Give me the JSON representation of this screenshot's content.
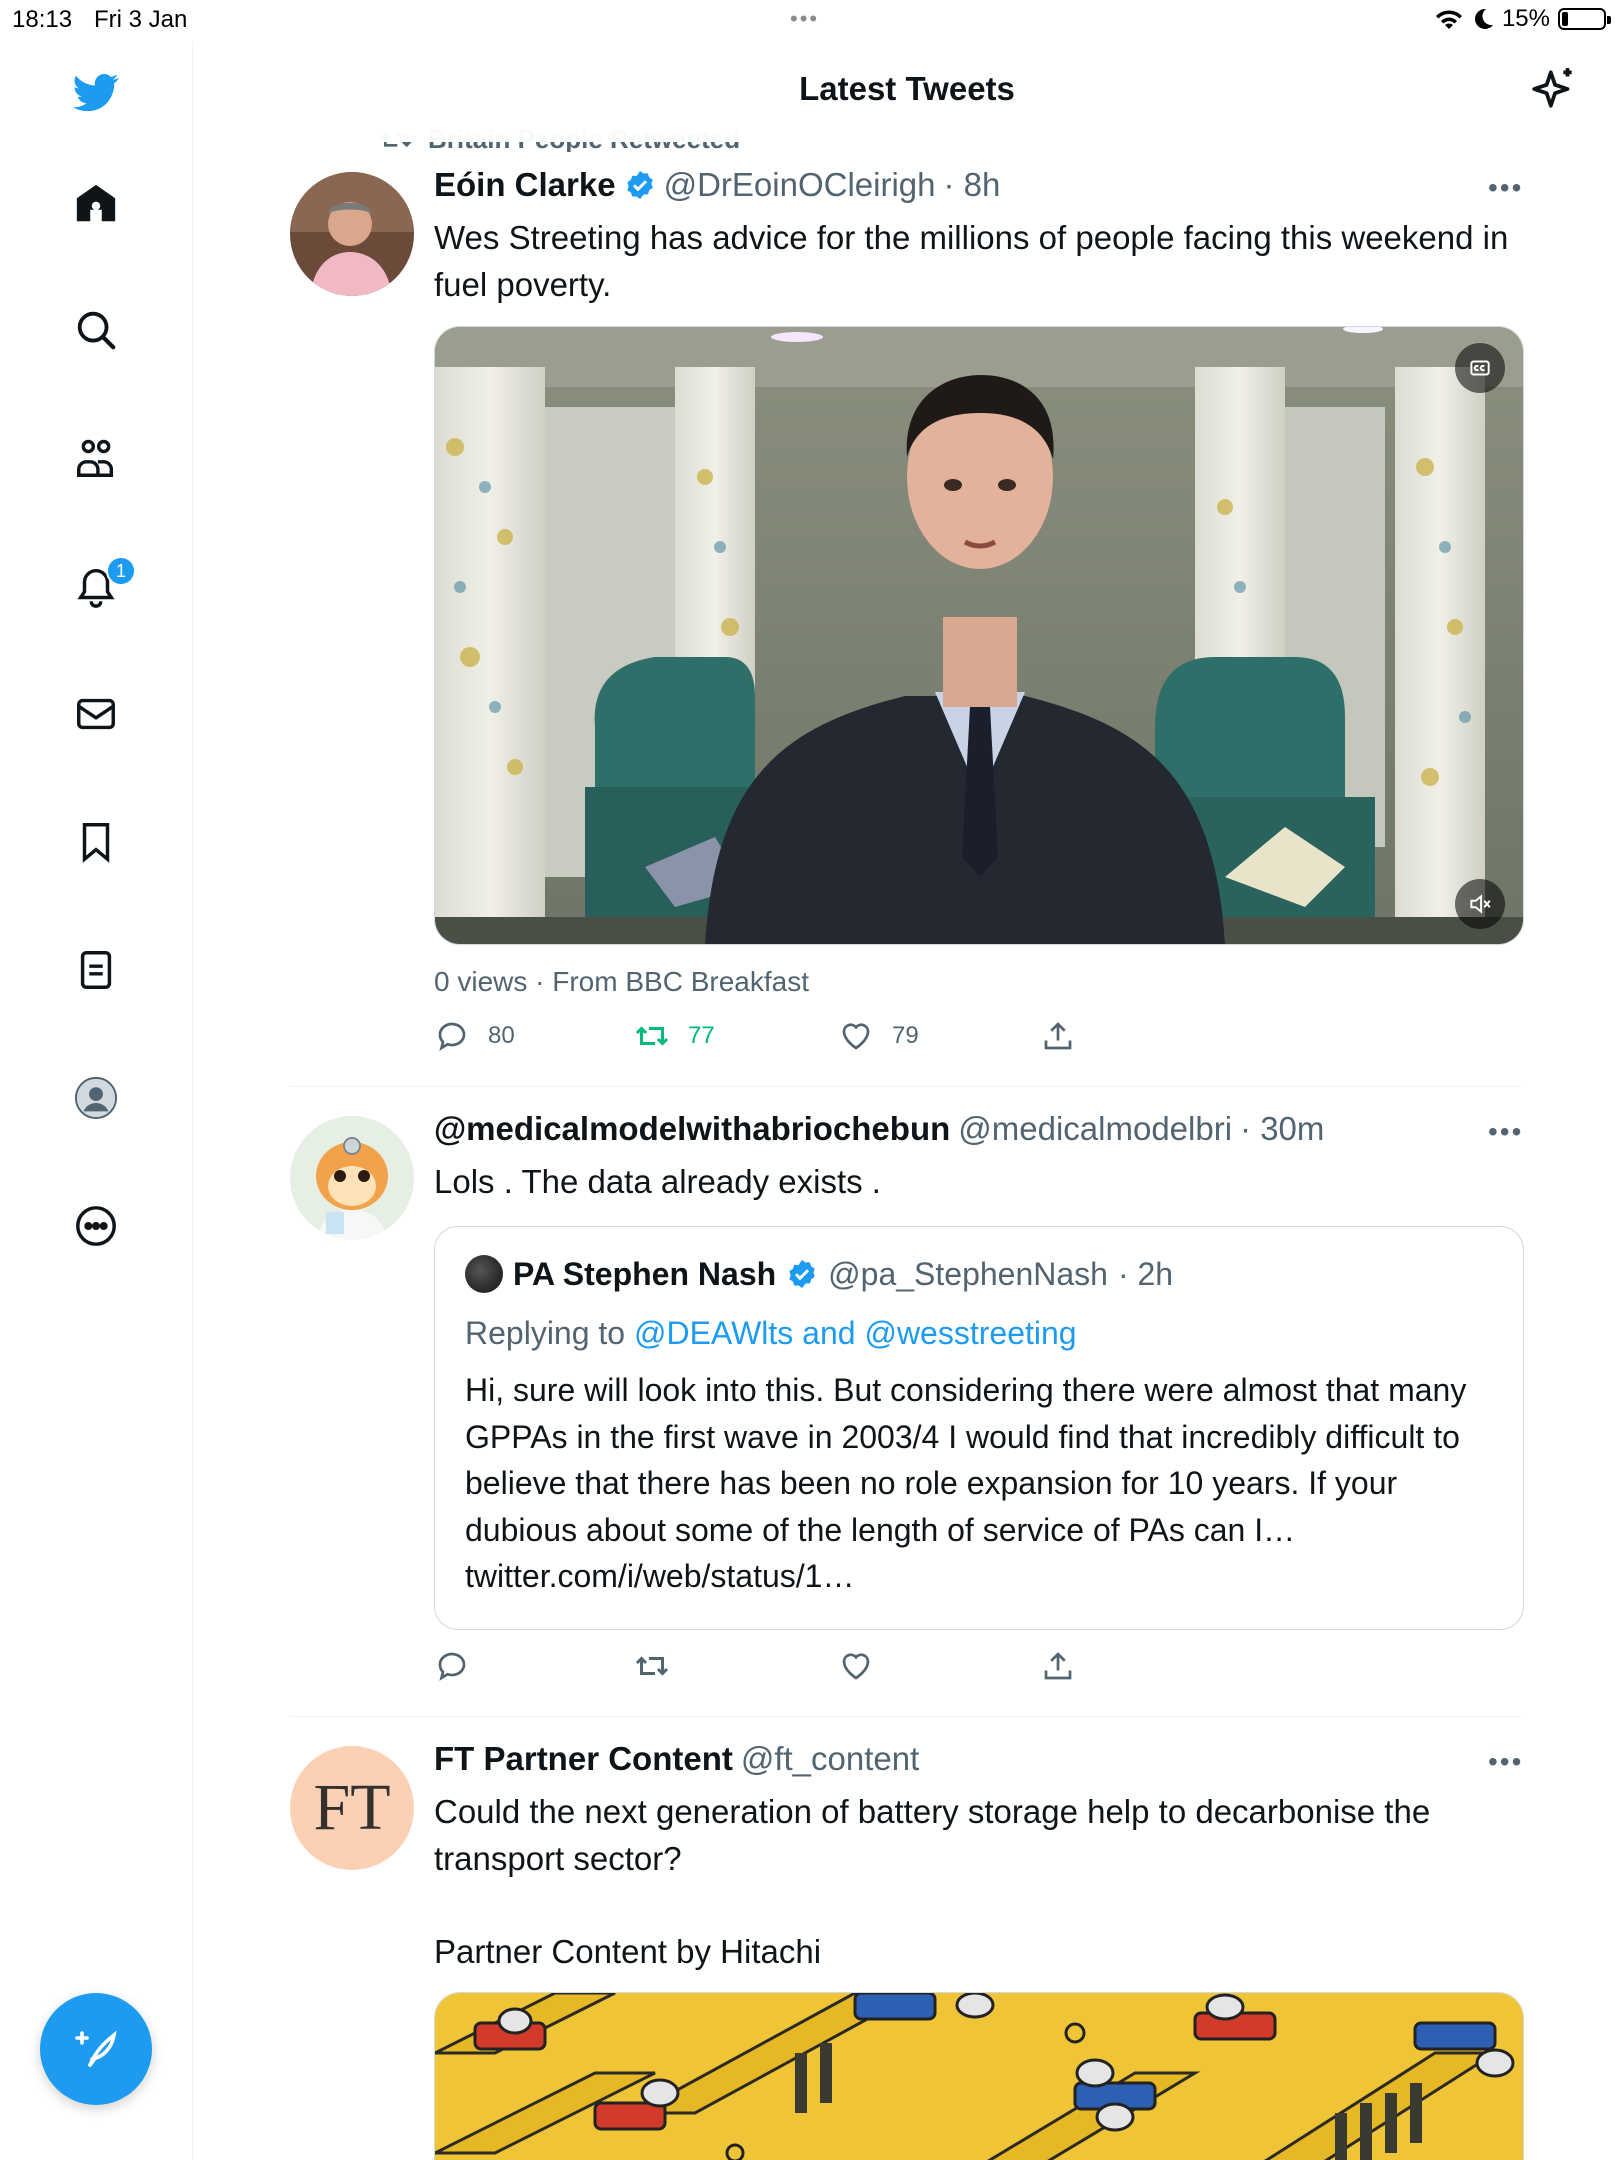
{
  "status_bar": {
    "time": "18:13",
    "date": "Fri 3 Jan",
    "dots": "•••",
    "battery": "15%",
    "battery_level": 0.15
  },
  "header": {
    "title": "Latest Tweets"
  },
  "sidebar": {
    "items": [
      {
        "name": "home-icon"
      },
      {
        "name": "search-icon"
      },
      {
        "name": "communities-icon"
      },
      {
        "name": "notifications-icon",
        "badge": "1"
      },
      {
        "name": "messages-icon"
      },
      {
        "name": "bookmarks-icon"
      },
      {
        "name": "lists-icon"
      },
      {
        "name": "profile-icon"
      },
      {
        "name": "more-icon"
      }
    ],
    "compose_icon": "compose-tweet-icon"
  },
  "tweets": [
    {
      "retweeted_by": "Britain People Retweeted",
      "name": "Eóin Clarke",
      "verified": true,
      "handle": "@DrEoinOCleirigh",
      "time": "· 8h",
      "text": "Wes Streeting has advice for the millions of people facing this weekend in fuel poverty.",
      "views": "0 views · From BBC Breakfast",
      "replies": "80",
      "retweets": "77",
      "likes": "79"
    },
    {
      "name": "@medicalmodelwithabriochebun",
      "handle": "@medicalmodelbri",
      "time": "· 30m",
      "text": "Lols . The data already exists .",
      "quote": {
        "name": "PA Stephen Nash",
        "verified": true,
        "handle": "@pa_StephenNash",
        "time": "· 2h",
        "replying_prefix": "Replying to",
        "replying_to": "@DEAWlts and @wesstreeting",
        "text": "Hi, sure will look into this. But considering there were almost that many GPPAs in the first wave in 2003/4 I would find that incredibly difficult to believe that there has been no role expansion for 10 years. If your dubious about some of the length of service of PAs can I… twitter.com/i/web/status/1…"
      }
    },
    {
      "name": "FT Partner Content",
      "handle": "@ft_content",
      "avatar_text": "FT",
      "text": "Could the next generation of battery storage help to decarbonise the transport sector?",
      "text2": "Partner Content by Hitachi"
    }
  ],
  "colors": {
    "accent": "#1d9bf0",
    "retweet_green": "#00ba7c",
    "secondary_text": "#536471"
  }
}
